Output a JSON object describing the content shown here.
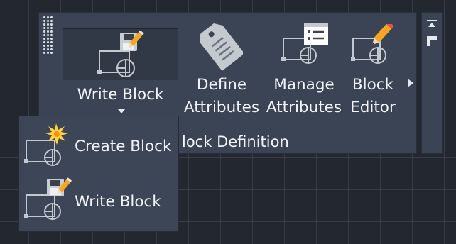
{
  "ribbon": {
    "panel_title": "lock Definition",
    "buttons": [
      {
        "line1": "Write Block",
        "line2": ""
      },
      {
        "line1": "Define",
        "line2": "Attributes"
      },
      {
        "line1": "Manage",
        "line2": "Attributes"
      },
      {
        "line1": "Block",
        "line2": "Editor"
      }
    ]
  },
  "dropdown": {
    "items": [
      {
        "label": "Create Block"
      },
      {
        "label": "Write Block"
      }
    ]
  },
  "colors": {
    "canvas_background": "#222730",
    "panel_background": "#3b4454",
    "icon_gray": "#aeb3bd",
    "icon_white": "#ffffff",
    "pencil_orange": "#f5a623",
    "star_yellow": "#ffd23f"
  }
}
